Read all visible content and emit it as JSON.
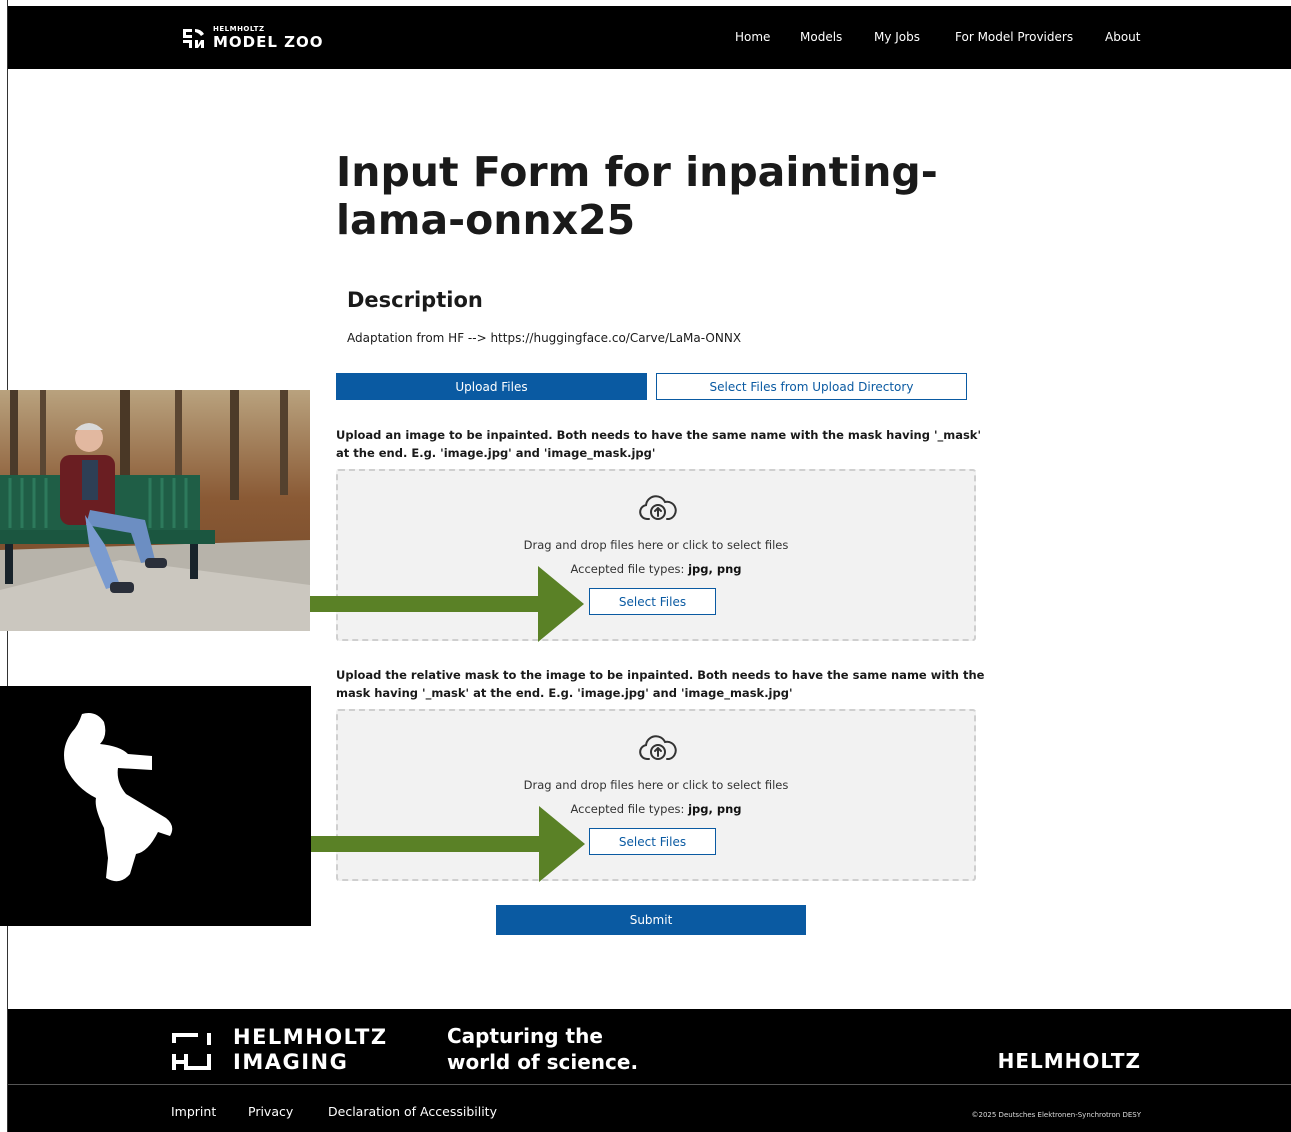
{
  "header": {
    "logo_small": "HELMHOLTZ",
    "logo_big": "MODEL ZOO",
    "nav": [
      {
        "label": "Home"
      },
      {
        "label": "Models"
      },
      {
        "label": "My Jobs"
      },
      {
        "label": "For Model Providers"
      },
      {
        "label": "About"
      }
    ]
  },
  "main": {
    "title": "Input Form for inpainting-lama-onnx25",
    "description_title": "Description",
    "description_text": "Adaptation from HF --> https://huggingface.co/Carve/LaMa-ONNX",
    "tabs": [
      {
        "label": "Upload Files",
        "active": true
      },
      {
        "label": "Select Files from Upload Directory",
        "active": false
      }
    ],
    "fields": [
      {
        "label": "Upload an image to be inpainted. Both needs to have the same name with the mask having '_mask' at the end. E.g. 'image.jpg' and 'image_mask.jpg'",
        "drop_text": "Drag and drop files here or click to select files",
        "accepted_prefix": "Accepted file types:",
        "accepted_types": "jpg, png",
        "button": "Select Files"
      },
      {
        "label": "Upload the relative mask to the image to be inpainted. Both needs to have the same name with the mask having '_mask' at the end. E.g. 'image.jpg' and 'image_mask.jpg'",
        "drop_text": "Drag and drop files here or click to select files",
        "accepted_prefix": "Accepted file types:",
        "accepted_types": "jpg, png",
        "button": "Select Files"
      }
    ],
    "submit": "Submit"
  },
  "footer": {
    "imaging_line1": "HELMHOLTZ",
    "imaging_line2": "IMAGING",
    "tagline_line1": "Capturing the",
    "tagline_line2": "world of science.",
    "brand": "HELMHOLTZ",
    "links": [
      {
        "label": "Imprint"
      },
      {
        "label": "Privacy"
      },
      {
        "label": "Declaration of Accessibility"
      }
    ],
    "copyright": "©2025 Deutsches Elektronen-Synchrotron DESY"
  },
  "colors": {
    "primary": "#0a5aa2",
    "arrow": "#5a8126",
    "header_bg": "#000000"
  }
}
